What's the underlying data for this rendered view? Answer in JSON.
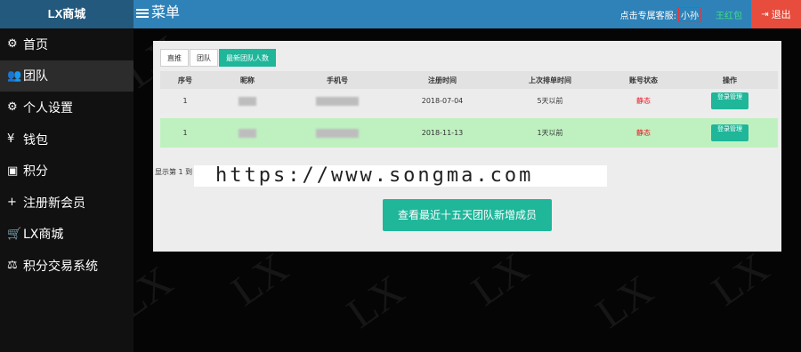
{
  "header": {
    "brand": "LX商城",
    "menu_label": "菜单",
    "customer_service_prefix": "点击专属客服:",
    "customer_service_name": "小孙",
    "inbox_label": "王红包",
    "logout_label": "退出"
  },
  "sidebar": {
    "items": [
      {
        "icon": "⚙",
        "label": "首页"
      },
      {
        "icon": "👥",
        "label": "团队"
      },
      {
        "icon": "⚙",
        "label": "个人设置"
      },
      {
        "icon": "¥",
        "label": "钱包"
      },
      {
        "icon": "▣",
        "label": "积分"
      },
      {
        "icon": "+",
        "label": "注册新会员"
      },
      {
        "icon": "🛒",
        "label": "LX商城"
      },
      {
        "icon": "⚖",
        "label": "积分交易系统"
      }
    ]
  },
  "tabs": [
    "直推",
    "团队",
    "最新团队人数"
  ],
  "table": {
    "headers": [
      "序号",
      "昵称",
      "手机号",
      "注册时间",
      "上次排单时间",
      "账号状态",
      "操作"
    ],
    "rows": [
      {
        "index": "1",
        "reg_time": "2018-07-04",
        "last_order": "5天以前",
        "status": "静态",
        "action": "登录管理"
      },
      {
        "index": "1",
        "reg_time": "2018-11-13",
        "last_order": "1天以前",
        "status": "静态",
        "action": "登录管理"
      }
    ]
  },
  "showing_text": "显示第 1 到",
  "watermark_url": "https://www.songma.com",
  "watermark_bg_text": "LX",
  "main_button": "查看最近十五天团队新增成员",
  "colors": {
    "accent": "#1fb69a",
    "header": "#2f82b8",
    "brand": "#23597d",
    "logout": "#e74c3c",
    "highlight_row": "#bff1c0"
  }
}
